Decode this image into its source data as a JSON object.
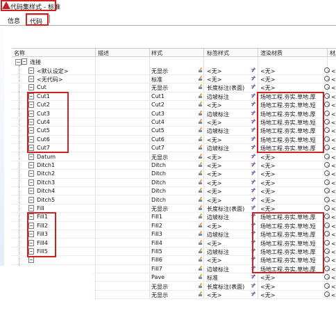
{
  "window": {
    "title": "代码集样式 - 标准"
  },
  "tabs": [
    {
      "label": "信息"
    },
    {
      "label": "代码"
    }
  ],
  "columns": {
    "name": "名称",
    "desc": "描述",
    "style": "样式",
    "tag": "标签样式",
    "mat": "渲染材质",
    "mat2": "材质"
  },
  "root": {
    "label": "连接"
  },
  "rows": [
    {
      "name": "<默认设定>",
      "style": "无显示",
      "tag": "<无>",
      "mat": "<无>",
      "mat2": "<无>"
    },
    {
      "name": "<无代码>",
      "style": "标准",
      "tag": "<无>",
      "mat": "<无>",
      "mat2": "<无>"
    },
    {
      "name": "Cut",
      "style": "无显示",
      "tag": "长度标注(表面)",
      "mat": "<无>",
      "mat2": "<无>"
    },
    {
      "name": "Cut1",
      "style": "Cut1",
      "tag": "边坡标注",
      "mat": "场地工程.夯实.草地.厚",
      "mat2": "<无>"
    },
    {
      "name": "Cut2",
      "style": "Cut2",
      "tag": "<无>",
      "mat": "场地工程.夯实.草地.短",
      "mat2": "<无>"
    },
    {
      "name": "Cut3",
      "style": "Cut3",
      "tag": "边坡标注",
      "mat": "场地工程.夯实.草地.厚",
      "mat2": "<无>"
    },
    {
      "name": "Cut4",
      "style": "Cut4",
      "tag": "<无>",
      "mat": "场地工程.夯实.草地.短",
      "mat2": "<无>"
    },
    {
      "name": "Cut5",
      "style": "Cut5",
      "tag": "边坡标注",
      "mat": "场地工程.夯实.草地.厚",
      "mat2": "<无>"
    },
    {
      "name": "Cut6",
      "style": "Cut6",
      "tag": "<无>",
      "mat": "场地工程.夯实.草地.短",
      "mat2": "<无>"
    },
    {
      "name": "Cut7",
      "style": "Cut7",
      "tag": "边坡标注",
      "mat": "场地工程.夯实.草地.厚",
      "mat2": "<无>"
    },
    {
      "name": "Datum",
      "style": "无显示",
      "tag": "<无>",
      "mat": "<无>",
      "mat2": "<无>"
    },
    {
      "name": "Ditch1",
      "style": "Ditch",
      "tag": "<无>",
      "mat": "<无>",
      "mat2": "<无>"
    },
    {
      "name": "Ditch2",
      "style": "Ditch",
      "tag": "<无>",
      "mat": "<无>",
      "mat2": "<无>"
    },
    {
      "name": "Ditch3",
      "style": "Ditch",
      "tag": "<无>",
      "mat": "<无>",
      "mat2": "<无>"
    },
    {
      "name": "Ditch4",
      "style": "Ditch",
      "tag": "<无>",
      "mat": "<无>",
      "mat2": "<无>"
    },
    {
      "name": "Ditch5",
      "style": "Ditch",
      "tag": "<无>",
      "mat": "<无>",
      "mat2": "<无>"
    },
    {
      "name": "Fill",
      "style": "无显示",
      "tag": "长度标注(表面)",
      "mat": "<无>",
      "mat2": "<无>"
    },
    {
      "name": "Fill1",
      "style": "Fill1",
      "tag": "边坡标注",
      "mat": "场地工程.夯实.草地.厚",
      "mat2": "<无>"
    },
    {
      "name": "Fill2",
      "style": "Fill2",
      "tag": "<无>",
      "mat": "场地工程.夯实.草地.短",
      "mat2": "<无>"
    },
    {
      "name": "Fill3",
      "style": "Fill3",
      "tag": "边坡标注",
      "mat": "场地工程.夯实.草地.厚",
      "mat2": "<无>"
    },
    {
      "name": "Fill4",
      "style": "Fill4",
      "tag": "<无>",
      "mat": "场地工程.夯实.草地.短",
      "mat2": "<无>"
    },
    {
      "name": "Fill5",
      "style": "Fill5",
      "tag": "边坡标注",
      "mat": "场地工程.夯实.草地.厚",
      "mat2": "<无>"
    },
    {
      "name": "",
      "style": "Fill6",
      "tag": "<无>",
      "mat": "场地工程.夯实.草地.短",
      "mat2": "<无>"
    },
    {
      "name": "",
      "style": "Fill7",
      "tag": "边坡标注",
      "mat": "场地工程.夯实.草地.厚",
      "mat2": "<无>"
    },
    {
      "name": "",
      "style": "Pave",
      "tag": "标准",
      "mat": "<无>",
      "mat2": "<无>"
    },
    {
      "name": "",
      "style": "无显示",
      "tag": "长度标注(表面)",
      "mat": "<无>",
      "mat2": "<无>"
    },
    {
      "name": "",
      "style": "无显示",
      "tag": "<无>",
      "mat": "<无>",
      "mat2": "<无>"
    }
  ]
}
